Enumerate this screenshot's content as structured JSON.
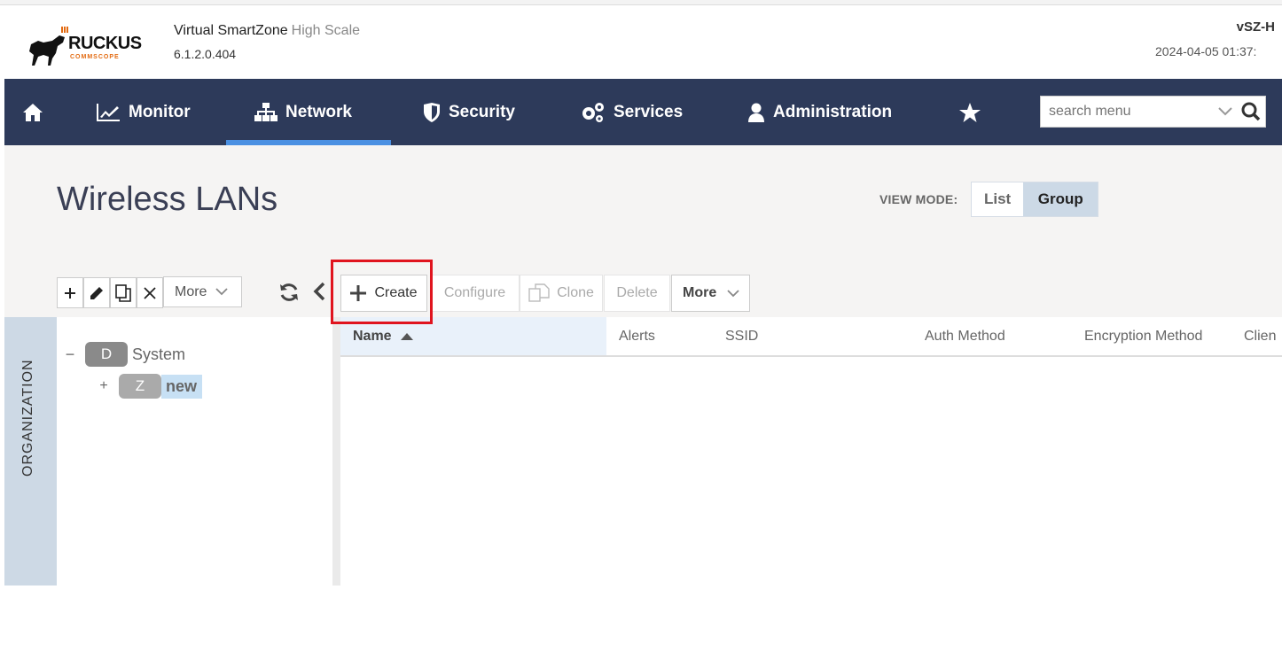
{
  "header": {
    "logo_text": "RUCKUS",
    "logo_sub": "COMMSCOPE",
    "product_name": "Virtual SmartZone",
    "product_edition": "High Scale",
    "version": "6.1.2.0.404",
    "hostname": "vSZ-H",
    "datetime": "2024-04-05  01:37:"
  },
  "nav": {
    "items": [
      {
        "label": "Monitor",
        "icon": "chart-line-icon"
      },
      {
        "label": "Network",
        "icon": "sitemap-icon",
        "active": true
      },
      {
        "label": "Security",
        "icon": "shield-icon"
      },
      {
        "label": "Services",
        "icon": "gears-icon"
      },
      {
        "label": "Administration",
        "icon": "user-icon"
      }
    ],
    "search_placeholder": "search menu"
  },
  "page": {
    "title": "Wireless LANs",
    "view_mode_label": "VIEW MODE:",
    "view_modes": [
      "List",
      "Group"
    ],
    "view_mode_selected": "Group"
  },
  "tree_toolbar": {
    "more_label": "More"
  },
  "grid_toolbar": {
    "create_label": "Create",
    "configure_label": "Configure",
    "clone_label": "Clone",
    "delete_label": "Delete",
    "more_label": "More"
  },
  "sidebar": {
    "org_label": "ORGANIZATION"
  },
  "tree": {
    "nodes": [
      {
        "badge": "D",
        "label": "System",
        "toggle": "−"
      },
      {
        "badge": "Z",
        "label": "new",
        "toggle": "+"
      }
    ]
  },
  "grid": {
    "columns": [
      "Name",
      "Alerts",
      "SSID",
      "Auth Method",
      "Encryption Method",
      "Clien"
    ],
    "sorted_column": "Name",
    "rows": []
  },
  "colors": {
    "nav_bg": "#2d3a5a",
    "nav_active": "#4a90e2",
    "highlight": "#e0141e",
    "brand_orange": "#e36b12"
  }
}
